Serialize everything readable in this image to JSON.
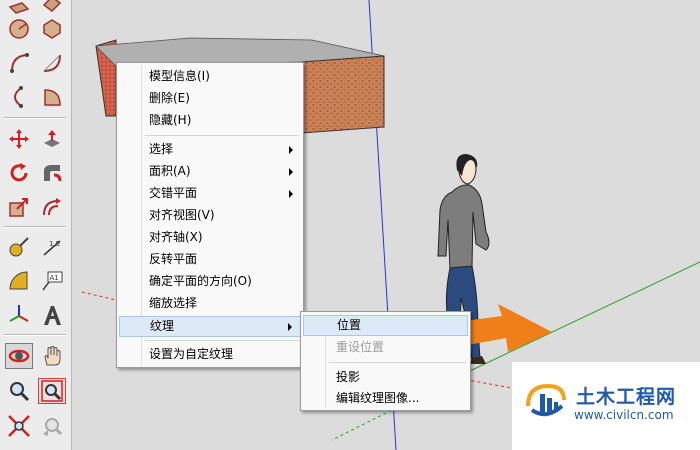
{
  "colors": {
    "accent": "#f07f1a",
    "menu_highlight": "#dde9f6",
    "axis_blue": "#3030d0",
    "axis_green": "#2ca02c",
    "axis_red": "#d03030",
    "wall_red_face": "#d8644f",
    "wall_brick": "#c77f55",
    "watermark_blue": "#1e5aa8"
  },
  "toolbar": {
    "tools": [
      "rectangle-icon",
      "rotated-rect-icon",
      "circle-icon",
      "polygon-icon",
      "arc-icon",
      "two-point-arc-icon",
      "three-point-arc-icon",
      "pie-icon",
      "move-icon",
      "push-pull-icon",
      "rotate-icon",
      "follow-me-icon",
      "scale-icon",
      "offset-icon",
      "tape-measure-icon",
      "dimension-icon",
      "protractor-icon",
      "text-icon",
      "axes-icon",
      "3d-text-icon",
      "orbit-icon",
      "pan-icon",
      "zoom-icon",
      "zoom-window-icon",
      "zoom-extents-icon",
      "previous-view-icon"
    ]
  },
  "context_menu": {
    "items": [
      {
        "label": "模型信息(I)"
      },
      {
        "label": "删除(E)"
      },
      {
        "label": "隐藏(H)"
      },
      {
        "label": "选择"
      },
      {
        "label": "面积(A)"
      },
      {
        "label": "交错平面"
      },
      {
        "label": "对齐视图(V)"
      },
      {
        "label": "对齐轴(X)"
      },
      {
        "label": "反转平面"
      },
      {
        "label": "确定平面的方向(O)"
      },
      {
        "label": "缩放选择"
      },
      {
        "label": "纹理"
      },
      {
        "label": "设置为自定纹理"
      }
    ]
  },
  "submenu": {
    "items": [
      {
        "label": "位置"
      },
      {
        "label": "重设位置"
      },
      {
        "label": "投影"
      },
      {
        "label": "编辑纹理图像..."
      }
    ]
  },
  "watermark": {
    "title": "土木工程网",
    "url": "www.civilcn.com"
  }
}
